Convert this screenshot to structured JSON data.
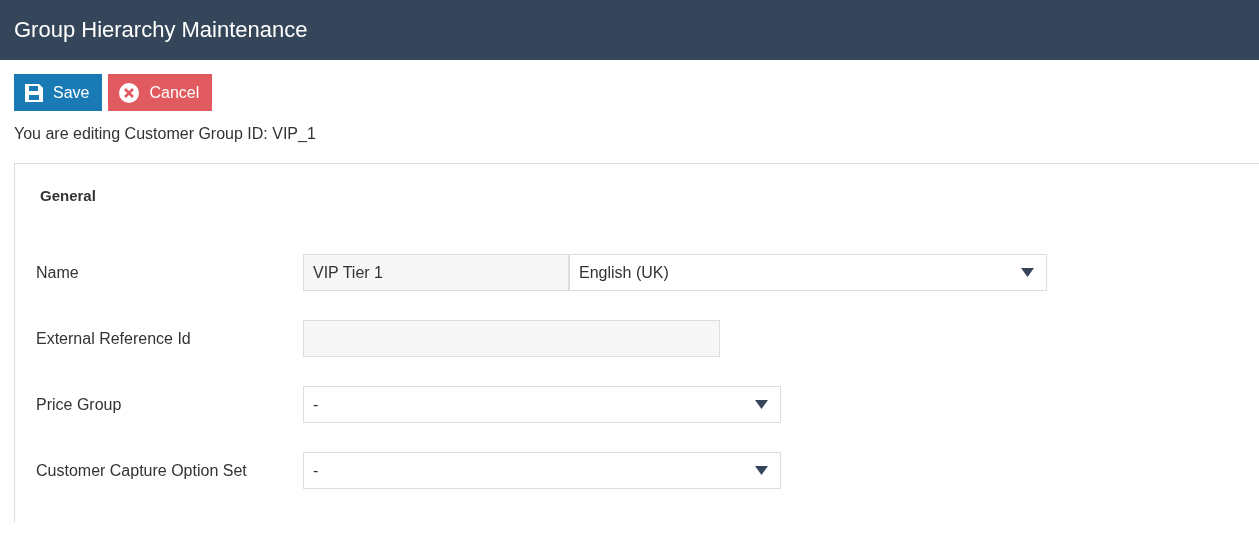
{
  "header": {
    "title": "Group Hierarchy Maintenance"
  },
  "actions": [
    {
      "kind": "save",
      "label": "Save"
    },
    {
      "kind": "cancel",
      "label": "Cancel"
    }
  ],
  "notice": "You are editing Customer Group ID: VIP_1",
  "section": {
    "title": "General",
    "fields": [
      {
        "kind": "text-with-language",
        "label": "Name",
        "value": "VIP Tier 1",
        "language": "English (UK)"
      },
      {
        "kind": "text",
        "label": "External Reference Id"
      },
      {
        "kind": "select",
        "label": "Price Group",
        "value": "-"
      },
      {
        "kind": "select",
        "label": "Customer Capture Option Set",
        "value": "-"
      }
    ]
  }
}
